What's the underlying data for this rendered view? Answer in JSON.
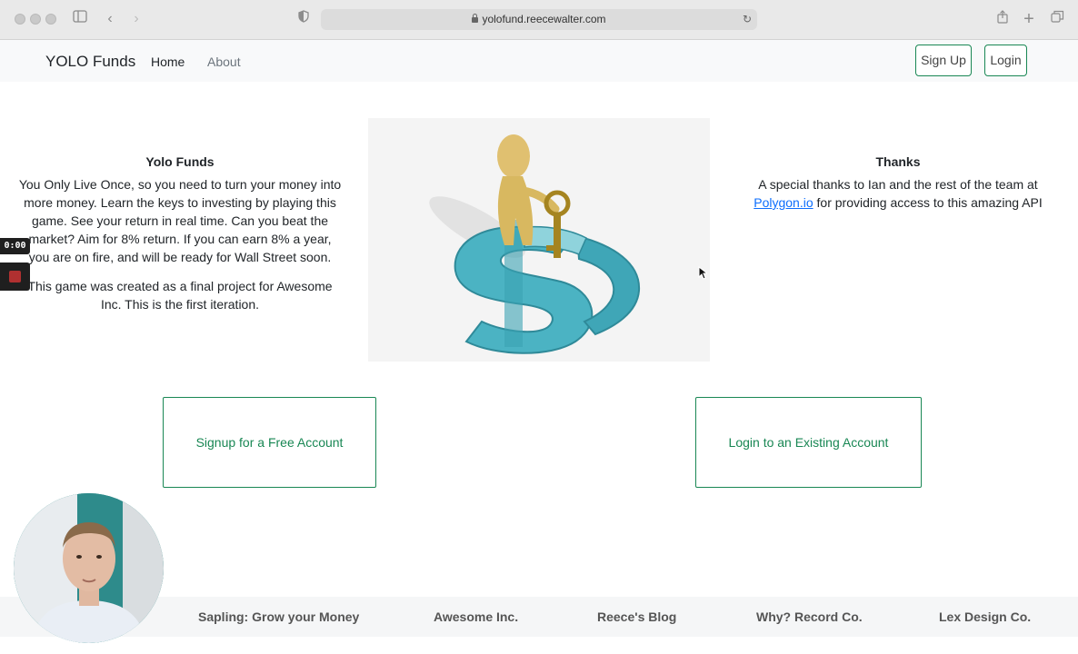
{
  "browser": {
    "url": "yolofund.reecewalter.com"
  },
  "navbar": {
    "brand": "YOLO Funds",
    "links": [
      "Home",
      "About"
    ],
    "signup_label": "Sign Up",
    "login_label": "Login"
  },
  "intro": {
    "title": "Yolo Funds",
    "paragraph1": "You Only Live Once, so you need to turn your money into more money. Learn the keys to investing by playing this game. See your return in real time. Can you beat the market? Aim for 8% return. If you can earn 8% a year, you are on fire, and will be ready for Wall Street soon.",
    "paragraph2": "This game was created as a final project for Awesome Inc. This is the first iteration."
  },
  "thanks": {
    "title": "Thanks",
    "text_before": "A special thanks to Ian and the rest of the team at ",
    "link": "Polygon.io",
    "text_after": " for providing access to this amazing API"
  },
  "cta": {
    "signup": "Signup for a Free Account",
    "login": "Login to an Existing Account"
  },
  "footer": {
    "links": [
      "Sapling: Grow your Money",
      "Awesome Inc.",
      "Reece's Blog",
      "Why? Record Co.",
      "Lex Design Co."
    ]
  },
  "recording": {
    "timer": "0:00"
  },
  "colors": {
    "accent": "#198754",
    "link": "#0d6efd",
    "navbar_bg": "#f8f9fa"
  }
}
